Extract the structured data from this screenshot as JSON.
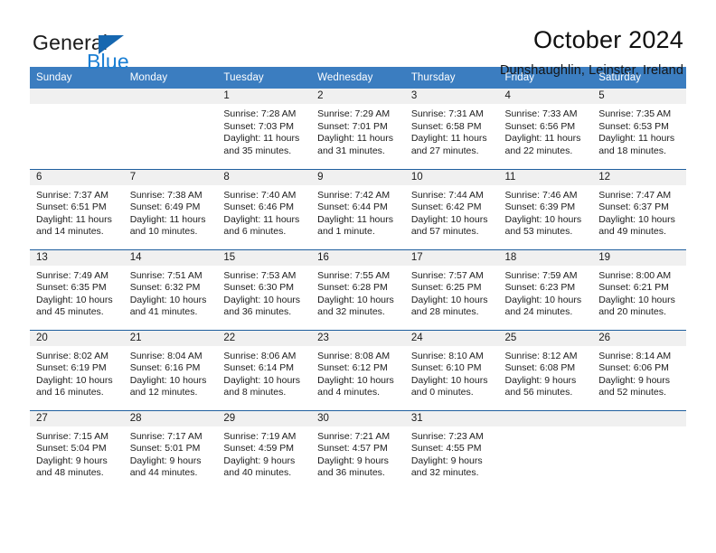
{
  "brand": {
    "word1": "General",
    "word2": "Blue",
    "triangle_color": "#1667b0",
    "blue_color": "#1a7fd4"
  },
  "header": {
    "title": "October 2024",
    "subtitle": "Dunshaughlin, Leinster, Ireland"
  },
  "theme": {
    "header_blue": "#3b7dc0",
    "rule_blue": "#1f5f9e",
    "daynum_bg": "#f0f0f0"
  },
  "weekdays": [
    "Sunday",
    "Monday",
    "Tuesday",
    "Wednesday",
    "Thursday",
    "Friday",
    "Saturday"
  ],
  "weeks": [
    [
      {
        "day": "",
        "empty": true
      },
      {
        "day": "",
        "empty": true
      },
      {
        "day": "1",
        "sunrise": "Sunrise: 7:28 AM",
        "sunset": "Sunset: 7:03 PM",
        "daylight1": "Daylight: 11 hours",
        "daylight2": "and 35 minutes."
      },
      {
        "day": "2",
        "sunrise": "Sunrise: 7:29 AM",
        "sunset": "Sunset: 7:01 PM",
        "daylight1": "Daylight: 11 hours",
        "daylight2": "and 31 minutes."
      },
      {
        "day": "3",
        "sunrise": "Sunrise: 7:31 AM",
        "sunset": "Sunset: 6:58 PM",
        "daylight1": "Daylight: 11 hours",
        "daylight2": "and 27 minutes."
      },
      {
        "day": "4",
        "sunrise": "Sunrise: 7:33 AM",
        "sunset": "Sunset: 6:56 PM",
        "daylight1": "Daylight: 11 hours",
        "daylight2": "and 22 minutes."
      },
      {
        "day": "5",
        "sunrise": "Sunrise: 7:35 AM",
        "sunset": "Sunset: 6:53 PM",
        "daylight1": "Daylight: 11 hours",
        "daylight2": "and 18 minutes."
      }
    ],
    [
      {
        "day": "6",
        "sunrise": "Sunrise: 7:37 AM",
        "sunset": "Sunset: 6:51 PM",
        "daylight1": "Daylight: 11 hours",
        "daylight2": "and 14 minutes."
      },
      {
        "day": "7",
        "sunrise": "Sunrise: 7:38 AM",
        "sunset": "Sunset: 6:49 PM",
        "daylight1": "Daylight: 11 hours",
        "daylight2": "and 10 minutes."
      },
      {
        "day": "8",
        "sunrise": "Sunrise: 7:40 AM",
        "sunset": "Sunset: 6:46 PM",
        "daylight1": "Daylight: 11 hours",
        "daylight2": "and 6 minutes."
      },
      {
        "day": "9",
        "sunrise": "Sunrise: 7:42 AM",
        "sunset": "Sunset: 6:44 PM",
        "daylight1": "Daylight: 11 hours",
        "daylight2": "and 1 minute."
      },
      {
        "day": "10",
        "sunrise": "Sunrise: 7:44 AM",
        "sunset": "Sunset: 6:42 PM",
        "daylight1": "Daylight: 10 hours",
        "daylight2": "and 57 minutes."
      },
      {
        "day": "11",
        "sunrise": "Sunrise: 7:46 AM",
        "sunset": "Sunset: 6:39 PM",
        "daylight1": "Daylight: 10 hours",
        "daylight2": "and 53 minutes."
      },
      {
        "day": "12",
        "sunrise": "Sunrise: 7:47 AM",
        "sunset": "Sunset: 6:37 PM",
        "daylight1": "Daylight: 10 hours",
        "daylight2": "and 49 minutes."
      }
    ],
    [
      {
        "day": "13",
        "sunrise": "Sunrise: 7:49 AM",
        "sunset": "Sunset: 6:35 PM",
        "daylight1": "Daylight: 10 hours",
        "daylight2": "and 45 minutes."
      },
      {
        "day": "14",
        "sunrise": "Sunrise: 7:51 AM",
        "sunset": "Sunset: 6:32 PM",
        "daylight1": "Daylight: 10 hours",
        "daylight2": "and 41 minutes."
      },
      {
        "day": "15",
        "sunrise": "Sunrise: 7:53 AM",
        "sunset": "Sunset: 6:30 PM",
        "daylight1": "Daylight: 10 hours",
        "daylight2": "and 36 minutes."
      },
      {
        "day": "16",
        "sunrise": "Sunrise: 7:55 AM",
        "sunset": "Sunset: 6:28 PM",
        "daylight1": "Daylight: 10 hours",
        "daylight2": "and 32 minutes."
      },
      {
        "day": "17",
        "sunrise": "Sunrise: 7:57 AM",
        "sunset": "Sunset: 6:25 PM",
        "daylight1": "Daylight: 10 hours",
        "daylight2": "and 28 minutes."
      },
      {
        "day": "18",
        "sunrise": "Sunrise: 7:59 AM",
        "sunset": "Sunset: 6:23 PM",
        "daylight1": "Daylight: 10 hours",
        "daylight2": "and 24 minutes."
      },
      {
        "day": "19",
        "sunrise": "Sunrise: 8:00 AM",
        "sunset": "Sunset: 6:21 PM",
        "daylight1": "Daylight: 10 hours",
        "daylight2": "and 20 minutes."
      }
    ],
    [
      {
        "day": "20",
        "sunrise": "Sunrise: 8:02 AM",
        "sunset": "Sunset: 6:19 PM",
        "daylight1": "Daylight: 10 hours",
        "daylight2": "and 16 minutes."
      },
      {
        "day": "21",
        "sunrise": "Sunrise: 8:04 AM",
        "sunset": "Sunset: 6:16 PM",
        "daylight1": "Daylight: 10 hours",
        "daylight2": "and 12 minutes."
      },
      {
        "day": "22",
        "sunrise": "Sunrise: 8:06 AM",
        "sunset": "Sunset: 6:14 PM",
        "daylight1": "Daylight: 10 hours",
        "daylight2": "and 8 minutes."
      },
      {
        "day": "23",
        "sunrise": "Sunrise: 8:08 AM",
        "sunset": "Sunset: 6:12 PM",
        "daylight1": "Daylight: 10 hours",
        "daylight2": "and 4 minutes."
      },
      {
        "day": "24",
        "sunrise": "Sunrise: 8:10 AM",
        "sunset": "Sunset: 6:10 PM",
        "daylight1": "Daylight: 10 hours",
        "daylight2": "and 0 minutes."
      },
      {
        "day": "25",
        "sunrise": "Sunrise: 8:12 AM",
        "sunset": "Sunset: 6:08 PM",
        "daylight1": "Daylight: 9 hours",
        "daylight2": "and 56 minutes."
      },
      {
        "day": "26",
        "sunrise": "Sunrise: 8:14 AM",
        "sunset": "Sunset: 6:06 PM",
        "daylight1": "Daylight: 9 hours",
        "daylight2": "and 52 minutes."
      }
    ],
    [
      {
        "day": "27",
        "sunrise": "Sunrise: 7:15 AM",
        "sunset": "Sunset: 5:04 PM",
        "daylight1": "Daylight: 9 hours",
        "daylight2": "and 48 minutes."
      },
      {
        "day": "28",
        "sunrise": "Sunrise: 7:17 AM",
        "sunset": "Sunset: 5:01 PM",
        "daylight1": "Daylight: 9 hours",
        "daylight2": "and 44 minutes."
      },
      {
        "day": "29",
        "sunrise": "Sunrise: 7:19 AM",
        "sunset": "Sunset: 4:59 PM",
        "daylight1": "Daylight: 9 hours",
        "daylight2": "and 40 minutes."
      },
      {
        "day": "30",
        "sunrise": "Sunrise: 7:21 AM",
        "sunset": "Sunset: 4:57 PM",
        "daylight1": "Daylight: 9 hours",
        "daylight2": "and 36 minutes."
      },
      {
        "day": "31",
        "sunrise": "Sunrise: 7:23 AM",
        "sunset": "Sunset: 4:55 PM",
        "daylight1": "Daylight: 9 hours",
        "daylight2": "and 32 minutes."
      },
      {
        "day": "",
        "empty": true
      },
      {
        "day": "",
        "empty": true
      }
    ]
  ]
}
